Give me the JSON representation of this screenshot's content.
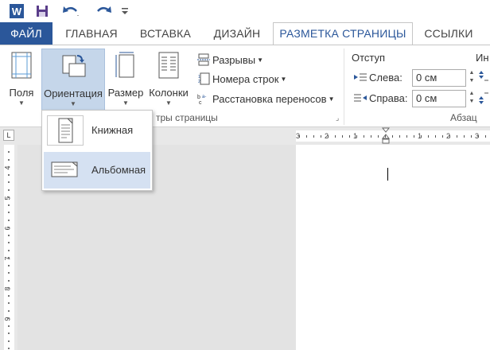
{
  "quick_access": {
    "app_icon": "word-icon",
    "save_icon": "save-icon",
    "undo_icon": "undo-icon",
    "redo_icon": "redo-icon",
    "customize_icon": "customize-arrow-icon"
  },
  "tabs": [
    {
      "label": "ФАЙЛ"
    },
    {
      "label": "ГЛАВНАЯ"
    },
    {
      "label": "ВСТАВКА"
    },
    {
      "label": "ДИЗАЙН"
    },
    {
      "label": "РАЗМЕТКА СТРАНИЦЫ"
    },
    {
      "label": "ССЫЛКИ"
    }
  ],
  "ribbon": {
    "margins_label": "Поля",
    "orientation_label": "Ориентация",
    "size_label": "Размер",
    "columns_label": "Колонки",
    "breaks_label": "Разрывы",
    "line_numbers_label": "Номера строк",
    "hyphenation_label": "Расстановка переносов",
    "page_setup_group_partial": "тры страницы",
    "indent_label": "Отступ",
    "indent_left_label": "Слева:",
    "indent_left_value": "0 см",
    "indent_right_label": "Справа:",
    "indent_right_value": "0 см",
    "spacing_label_partial": "Ин",
    "paragraph_group_label": "Абзац"
  },
  "orientation_menu": {
    "items": [
      {
        "label": "Книжная",
        "icon": "portrait-page-icon"
      },
      {
        "label": "Альбомная",
        "icon": "landscape-page-icon"
      }
    ]
  },
  "ruler": {
    "top_numbers": [
      "3",
      "2",
      "1",
      "1",
      "2",
      "3"
    ],
    "left_numbers": [
      "4",
      "5",
      "6",
      "7",
      "8",
      "9"
    ]
  },
  "colors": {
    "accent": "#2b579a",
    "selection": "#c5d6ea",
    "hover": "#d5e1f2"
  }
}
